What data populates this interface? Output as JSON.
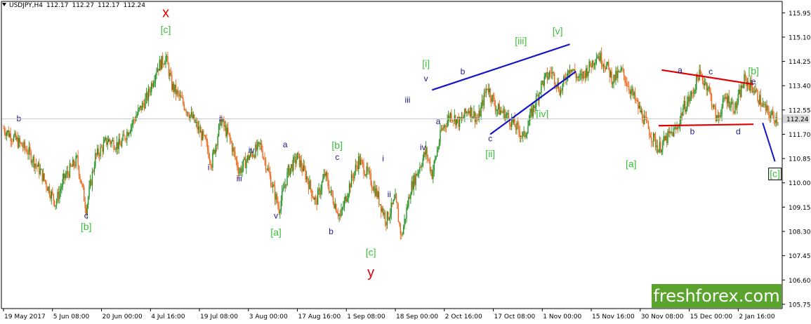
{
  "header": {
    "symbol": "USDJPY,H4",
    "open": "112.17",
    "high": "112.27",
    "low": "112.17",
    "close": "112.24"
  },
  "logo": {
    "text": "freshforex.com"
  },
  "colors": {
    "background": "#ffffff",
    "bull_candle": "#1f8f1f",
    "bear_candle": "#e8681c",
    "wave_label_green": "#39c03a",
    "wave_label_blue": "#1a1a8c",
    "wave_label_red": "#e00000",
    "trendline_blue": "#1515c8",
    "trendline_red": "#e00000",
    "logo_bg": "#5aa32d"
  },
  "chart_data": {
    "type": "candlestick",
    "title": "",
    "current_price_label": "112.24",
    "y_ticks": [
      "115.95",
      "115.10",
      "114.25",
      "113.40",
      "112.55",
      "111.70",
      "110.85",
      "110.00",
      "109.15",
      "108.30",
      "107.45",
      "106.60",
      "105.75"
    ],
    "y_tick_values": [
      115.95,
      115.1,
      114.25,
      113.4,
      112.55,
      111.7,
      110.85,
      110.0,
      109.15,
      108.3,
      107.45,
      106.6,
      105.75
    ],
    "ylim": [
      105.6,
      116.35
    ],
    "x_tick_labels": [
      "19 May 2017",
      "5 Jun 08:00",
      "20 Jun 00:00",
      "4 Jul 16:00",
      "19 Jul 08:00",
      "3 Aug 00:00",
      "17 Aug 16:00",
      "1 Sep 08:00",
      "18 Sep 00:00",
      "2 Oct 16:00",
      "17 Oct 08:00",
      "1 Nov 00:00",
      "15 Nov 16:00",
      "30 Nov 08:00",
      "15 Dec 00:00",
      "2 Jan 16:00"
    ],
    "x_tick_index": [
      0,
      16,
      32,
      48,
      64,
      80,
      96,
      112,
      128,
      144,
      160,
      176,
      192,
      208,
      224,
      240
    ],
    "x_max": 253,
    "price_path": [
      [
        0,
        111.9
      ],
      [
        4,
        111.5
      ],
      [
        8,
        111.1
      ],
      [
        12,
        110.4
      ],
      [
        17,
        109.3
      ],
      [
        20,
        110.2
      ],
      [
        24,
        110.8
      ],
      [
        27,
        109.1
      ],
      [
        30,
        110.9
      ],
      [
        34,
        111.5
      ],
      [
        38,
        111.3
      ],
      [
        42,
        112.1
      ],
      [
        47,
        113.0
      ],
      [
        50,
        114.0
      ],
      [
        53,
        114.4
      ],
      [
        55,
        113.4
      ],
      [
        58,
        112.9
      ],
      [
        62,
        112.2
      ],
      [
        66,
        111.4
      ],
      [
        68,
        110.7
      ],
      [
        71,
        112.2
      ],
      [
        74,
        111.5
      ],
      [
        77,
        110.4
      ],
      [
        80,
        110.9
      ],
      [
        84,
        111.3
      ],
      [
        87,
        110.2
      ],
      [
        90,
        109.1
      ],
      [
        93,
        110.4
      ],
      [
        96,
        110.9
      ],
      [
        99,
        110.2
      ],
      [
        102,
        109.3
      ],
      [
        105,
        110.3
      ],
      [
        107,
        109.6
      ],
      [
        110,
        108.8
      ],
      [
        113,
        109.9
      ],
      [
        116,
        110.8
      ],
      [
        119,
        110.3
      ],
      [
        122,
        109.6
      ],
      [
        125,
        108.7
      ],
      [
        128,
        109.4
      ],
      [
        130,
        108.1
      ],
      [
        133,
        109.8
      ],
      [
        136,
        110.6
      ],
      [
        138,
        111.1
      ],
      [
        140,
        110.3
      ],
      [
        143,
        111.8
      ],
      [
        146,
        112.4
      ],
      [
        149,
        112.1
      ],
      [
        152,
        112.6
      ],
      [
        155,
        112.2
      ],
      [
        158,
        113.4
      ],
      [
        161,
        112.6
      ],
      [
        164,
        112.4
      ],
      [
        167,
        112.0
      ],
      [
        170,
        111.6
      ],
      [
        173,
        112.6
      ],
      [
        176,
        113.5
      ],
      [
        179,
        113.9
      ],
      [
        182,
        113.2
      ],
      [
        185,
        114.1
      ],
      [
        188,
        113.6
      ],
      [
        191,
        114.0
      ],
      [
        194,
        114.5
      ],
      [
        197,
        114.1
      ],
      [
        199,
        113.6
      ],
      [
        202,
        113.9
      ],
      [
        205,
        113.2
      ],
      [
        208,
        112.5
      ],
      [
        211,
        111.8
      ],
      [
        214,
        111.2
      ],
      [
        217,
        111.6
      ],
      [
        220,
        111.9
      ],
      [
        222,
        112.6
      ],
      [
        225,
        113.1
      ],
      [
        227,
        113.8
      ],
      [
        230,
        113.4
      ],
      [
        233,
        112.2
      ],
      [
        236,
        113.0
      ],
      [
        239,
        112.6
      ],
      [
        242,
        113.6
      ],
      [
        245,
        113.3
      ],
      [
        248,
        112.7
      ],
      [
        250,
        112.4
      ],
      [
        253,
        112.24
      ]
    ],
    "wave_labels": [
      {
        "text": "b",
        "i": 5,
        "p": 112.15,
        "c": "blue"
      },
      {
        "text": "c",
        "i": 27,
        "p": 108.75,
        "c": "blue"
      },
      {
        "text": "[b]",
        "i": 27,
        "p": 108.35,
        "c": "green"
      },
      {
        "text": "x",
        "i": 53,
        "p": 115.8,
        "c": "red"
      },
      {
        "text": "[c]",
        "i": 53,
        "p": 115.25,
        "c": "green"
      },
      {
        "text": "ii",
        "i": 71,
        "p": 112.15,
        "c": "blue"
      },
      {
        "text": "i",
        "i": 67,
        "p": 110.45,
        "c": "blue"
      },
      {
        "text": "iii",
        "i": 77,
        "p": 110.05,
        "c": "blue"
      },
      {
        "text": "iv",
        "i": 81,
        "p": 111.05,
        "c": "blue"
      },
      {
        "text": "a",
        "i": 92,
        "p": 111.25,
        "c": "blue"
      },
      {
        "text": "v",
        "i": 89,
        "p": 108.75,
        "c": "blue"
      },
      {
        "text": "[a]",
        "i": 89,
        "p": 108.15,
        "c": "green"
      },
      {
        "text": "[b]",
        "i": 109,
        "p": 111.2,
        "c": "green"
      },
      {
        "text": "c",
        "i": 109,
        "p": 110.8,
        "c": "blue"
      },
      {
        "text": "b",
        "i": 107,
        "p": 108.2,
        "c": "blue"
      },
      {
        "text": "[c]",
        "i": 120,
        "p": 107.45,
        "c": "green"
      },
      {
        "text": "y",
        "i": 120,
        "p": 106.7,
        "c": "red"
      },
      {
        "text": "i",
        "i": 124,
        "p": 110.75,
        "c": "blue"
      },
      {
        "text": "ii",
        "i": 126,
        "p": 109.5,
        "c": "blue"
      },
      {
        "text": "iii",
        "i": 132,
        "p": 112.8,
        "c": "blue"
      },
      {
        "text": "iv",
        "i": 137,
        "p": 111.15,
        "c": "blue"
      },
      {
        "text": "[i]",
        "i": 138,
        "p": 114.05,
        "c": "green"
      },
      {
        "text": "v",
        "i": 138,
        "p": 113.55,
        "c": "blue"
      },
      {
        "text": "a",
        "i": 142,
        "p": 112.05,
        "c": "blue"
      },
      {
        "text": "b",
        "i": 150,
        "p": 113.8,
        "c": "blue"
      },
      {
        "text": "c",
        "i": 159,
        "p": 111.45,
        "c": "blue"
      },
      {
        "text": "[ii]",
        "i": 159,
        "p": 110.9,
        "c": "green"
      },
      {
        "text": "[iii]",
        "i": 169,
        "p": 114.85,
        "c": "green"
      },
      {
        "text": "[iv]",
        "i": 176,
        "p": 112.3,
        "c": "green"
      },
      {
        "text": "[v]",
        "i": 181,
        "p": 115.2,
        "c": "green"
      },
      {
        "text": "[a]",
        "i": 205,
        "p": 110.55,
        "c": "green"
      },
      {
        "text": "a",
        "i": 221,
        "p": 113.85,
        "c": "blue"
      },
      {
        "text": "b",
        "i": 225,
        "p": 111.7,
        "c": "blue"
      },
      {
        "text": "c",
        "i": 231,
        "p": 113.8,
        "c": "blue"
      },
      {
        "text": "d",
        "i": 240,
        "p": 111.7,
        "c": "blue"
      },
      {
        "text": "[b]",
        "i": 245,
        "p": 113.8,
        "c": "green"
      },
      {
        "text": "e",
        "i": 245,
        "p": 113.45,
        "c": "blue"
      }
    ],
    "trendlines": [
      {
        "c": "blue",
        "a": [
          140,
          113.25
        ],
        "b": [
          185,
          114.85
        ]
      },
      {
        "c": "blue",
        "a": [
          159,
          111.7
        ],
        "b": [
          187,
          113.9
        ]
      },
      {
        "c": "red",
        "a": [
          215,
          113.95
        ],
        "b": [
          245,
          113.45
        ]
      },
      {
        "c": "red",
        "a": [
          214,
          112.0
        ],
        "b": [
          245,
          112.05
        ]
      }
    ],
    "projection": {
      "from": [
        248,
        112.1
      ],
      "to": [
        252,
        110.75
      ]
    },
    "target_label": {
      "text": "[c]",
      "i": 252,
      "p": 110.2
    }
  }
}
